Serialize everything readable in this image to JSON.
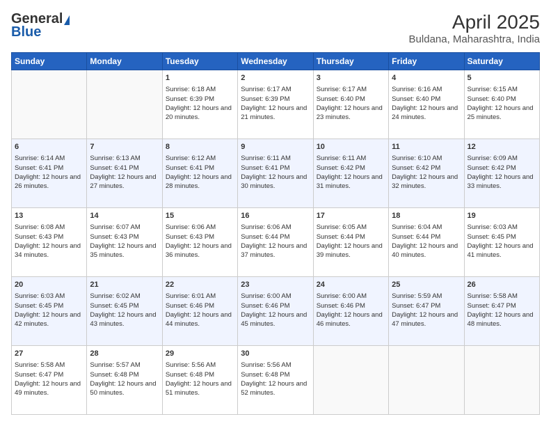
{
  "header": {
    "logo_general": "General",
    "logo_blue": "Blue",
    "month_title": "April 2025",
    "location": "Buldana, Maharashtra, India"
  },
  "days_of_week": [
    "Sunday",
    "Monday",
    "Tuesday",
    "Wednesday",
    "Thursday",
    "Friday",
    "Saturday"
  ],
  "weeks": [
    [
      {
        "day": "",
        "data": ""
      },
      {
        "day": "",
        "data": ""
      },
      {
        "day": "1",
        "sunrise": "6:18 AM",
        "sunset": "6:39 PM",
        "daylight": "12 hours and 20 minutes."
      },
      {
        "day": "2",
        "sunrise": "6:17 AM",
        "sunset": "6:39 PM",
        "daylight": "12 hours and 21 minutes."
      },
      {
        "day": "3",
        "sunrise": "6:17 AM",
        "sunset": "6:40 PM",
        "daylight": "12 hours and 23 minutes."
      },
      {
        "day": "4",
        "sunrise": "6:16 AM",
        "sunset": "6:40 PM",
        "daylight": "12 hours and 24 minutes."
      },
      {
        "day": "5",
        "sunrise": "6:15 AM",
        "sunset": "6:40 PM",
        "daylight": "12 hours and 25 minutes."
      }
    ],
    [
      {
        "day": "6",
        "sunrise": "6:14 AM",
        "sunset": "6:41 PM",
        "daylight": "12 hours and 26 minutes."
      },
      {
        "day": "7",
        "sunrise": "6:13 AM",
        "sunset": "6:41 PM",
        "daylight": "12 hours and 27 minutes."
      },
      {
        "day": "8",
        "sunrise": "6:12 AM",
        "sunset": "6:41 PM",
        "daylight": "12 hours and 28 minutes."
      },
      {
        "day": "9",
        "sunrise": "6:11 AM",
        "sunset": "6:41 PM",
        "daylight": "12 hours and 30 minutes."
      },
      {
        "day": "10",
        "sunrise": "6:11 AM",
        "sunset": "6:42 PM",
        "daylight": "12 hours and 31 minutes."
      },
      {
        "day": "11",
        "sunrise": "6:10 AM",
        "sunset": "6:42 PM",
        "daylight": "12 hours and 32 minutes."
      },
      {
        "day": "12",
        "sunrise": "6:09 AM",
        "sunset": "6:42 PM",
        "daylight": "12 hours and 33 minutes."
      }
    ],
    [
      {
        "day": "13",
        "sunrise": "6:08 AM",
        "sunset": "6:43 PM",
        "daylight": "12 hours and 34 minutes."
      },
      {
        "day": "14",
        "sunrise": "6:07 AM",
        "sunset": "6:43 PM",
        "daylight": "12 hours and 35 minutes."
      },
      {
        "day": "15",
        "sunrise": "6:06 AM",
        "sunset": "6:43 PM",
        "daylight": "12 hours and 36 minutes."
      },
      {
        "day": "16",
        "sunrise": "6:06 AM",
        "sunset": "6:44 PM",
        "daylight": "12 hours and 37 minutes."
      },
      {
        "day": "17",
        "sunrise": "6:05 AM",
        "sunset": "6:44 PM",
        "daylight": "12 hours and 39 minutes."
      },
      {
        "day": "18",
        "sunrise": "6:04 AM",
        "sunset": "6:44 PM",
        "daylight": "12 hours and 40 minutes."
      },
      {
        "day": "19",
        "sunrise": "6:03 AM",
        "sunset": "6:45 PM",
        "daylight": "12 hours and 41 minutes."
      }
    ],
    [
      {
        "day": "20",
        "sunrise": "6:03 AM",
        "sunset": "6:45 PM",
        "daylight": "12 hours and 42 minutes."
      },
      {
        "day": "21",
        "sunrise": "6:02 AM",
        "sunset": "6:45 PM",
        "daylight": "12 hours and 43 minutes."
      },
      {
        "day": "22",
        "sunrise": "6:01 AM",
        "sunset": "6:46 PM",
        "daylight": "12 hours and 44 minutes."
      },
      {
        "day": "23",
        "sunrise": "6:00 AM",
        "sunset": "6:46 PM",
        "daylight": "12 hours and 45 minutes."
      },
      {
        "day": "24",
        "sunrise": "6:00 AM",
        "sunset": "6:46 PM",
        "daylight": "12 hours and 46 minutes."
      },
      {
        "day": "25",
        "sunrise": "5:59 AM",
        "sunset": "6:47 PM",
        "daylight": "12 hours and 47 minutes."
      },
      {
        "day": "26",
        "sunrise": "5:58 AM",
        "sunset": "6:47 PM",
        "daylight": "12 hours and 48 minutes."
      }
    ],
    [
      {
        "day": "27",
        "sunrise": "5:58 AM",
        "sunset": "6:47 PM",
        "daylight": "12 hours and 49 minutes."
      },
      {
        "day": "28",
        "sunrise": "5:57 AM",
        "sunset": "6:48 PM",
        "daylight": "12 hours and 50 minutes."
      },
      {
        "day": "29",
        "sunrise": "5:56 AM",
        "sunset": "6:48 PM",
        "daylight": "12 hours and 51 minutes."
      },
      {
        "day": "30",
        "sunrise": "5:56 AM",
        "sunset": "6:48 PM",
        "daylight": "12 hours and 52 minutes."
      },
      {
        "day": "",
        "data": ""
      },
      {
        "day": "",
        "data": ""
      },
      {
        "day": "",
        "data": ""
      }
    ]
  ],
  "labels": {
    "sunrise": "Sunrise:",
    "sunset": "Sunset:",
    "daylight": "Daylight:"
  }
}
